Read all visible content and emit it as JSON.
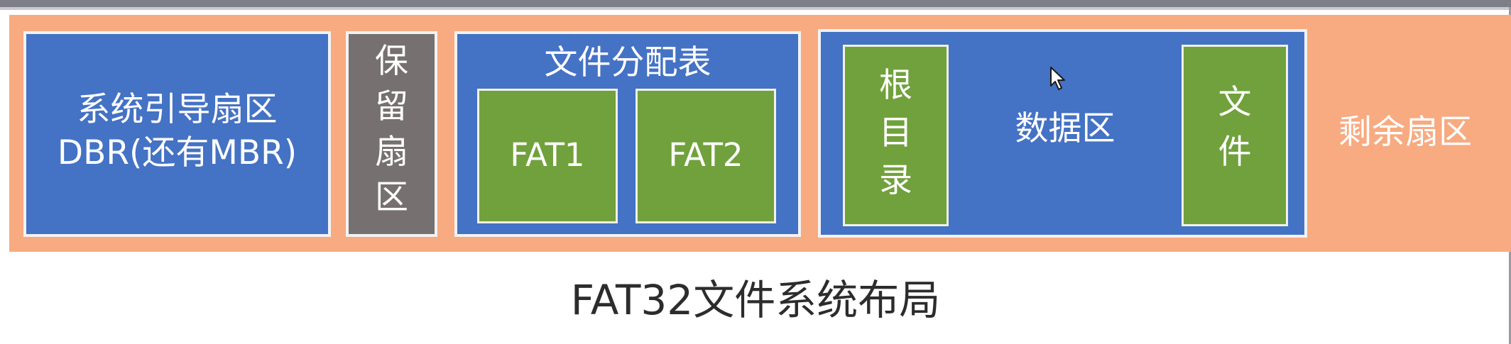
{
  "diagram": {
    "caption": "FAT32文件系统布局",
    "boot_sector": {
      "line1": "系统引导扇区",
      "line2": "DBR(还有MBR)"
    },
    "reserved": [
      "保",
      "留",
      "扇",
      "区"
    ],
    "fat_table": {
      "title": "文件分配表",
      "fat1": "FAT1",
      "fat2": "FAT2"
    },
    "data_area": {
      "label": "数据区",
      "root_dir": [
        "根",
        "目",
        "录"
      ],
      "file": [
        "文",
        "件"
      ]
    },
    "remaining": "剩余扇区"
  },
  "colors": {
    "layout_bar": "#f8aa80",
    "region_blue": "#4472c4",
    "reserved_gray": "#777070",
    "sub_green": "#71a13c"
  },
  "icons": [
    "mouse-cursor-icon"
  ]
}
